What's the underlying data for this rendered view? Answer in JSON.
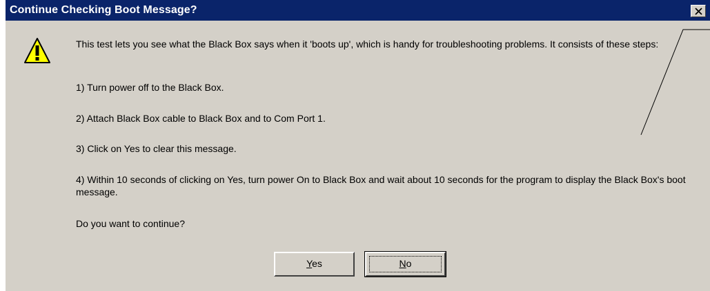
{
  "dialog": {
    "title": "Continue Checking Boot Message?",
    "close_icon": "close-icon",
    "warning_icon": "warning-icon"
  },
  "message": {
    "intro": "This test lets you see what the Black Box says when it 'boots up', which is handy for troubleshooting problems.  It consists of these steps:",
    "step1": "1)  Turn power off to the Black Box.",
    "step2": "2)  Attach Black Box cable to Black Box and to Com Port 1.",
    "step3": "3)  Click on Yes to clear this message.",
    "step4": "4)  Within 10 seconds of clicking on Yes, turn power On to Black Box and wait about 10 seconds for the program to display the Black Box's boot message.",
    "question": "Do you want to continue?"
  },
  "buttons": {
    "yes_accel": "Y",
    "yes_rest": "es",
    "no_accel": "N",
    "no_rest": "o"
  },
  "colors": {
    "titlebar": "#0a246a",
    "dialog_bg": "#d4d0c8",
    "warning_fill": "#ffff00"
  }
}
